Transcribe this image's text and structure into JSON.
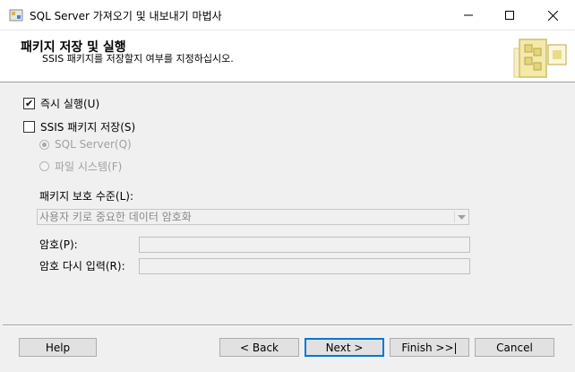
{
  "window": {
    "title": "SQL Server 가져오기 및 내보내기 마법사"
  },
  "header": {
    "title": "패키지 저장 및 실행",
    "subtitle": "SSIS 패키지를 저장할지 여부를 지정하십시오."
  },
  "options": {
    "run_now": {
      "label": "즉시 실행(U)",
      "checked": true
    },
    "save_package": {
      "label": "SSIS 패키지 저장(S)",
      "checked": false
    },
    "sql_server": {
      "label": "SQL Server(Q)",
      "selected": true
    },
    "file_system": {
      "label": "파일 시스템(F)",
      "selected": false
    }
  },
  "protection": {
    "label": "패키지 보호 수준(L):",
    "value": "사용자 키로 중요한 데이터 암호화"
  },
  "password": {
    "label": "암호(P):",
    "value": ""
  },
  "password_confirm": {
    "label": "암호 다시 입력(R):",
    "value": ""
  },
  "buttons": {
    "help": "Help",
    "back": "< Back",
    "next": "Next >",
    "finish": "Finish >>|",
    "cancel": "Cancel"
  },
  "colors": {
    "accent": "#0078d7",
    "button_face": "#e1e1e1",
    "dialog_bg": "#f0f0f0"
  },
  "icons": [
    "app-icon",
    "minimize-icon",
    "maximize-icon",
    "close-icon",
    "wizard-graphic-icon",
    "checkmark-icon",
    "dropdown-arrow-icon"
  ]
}
